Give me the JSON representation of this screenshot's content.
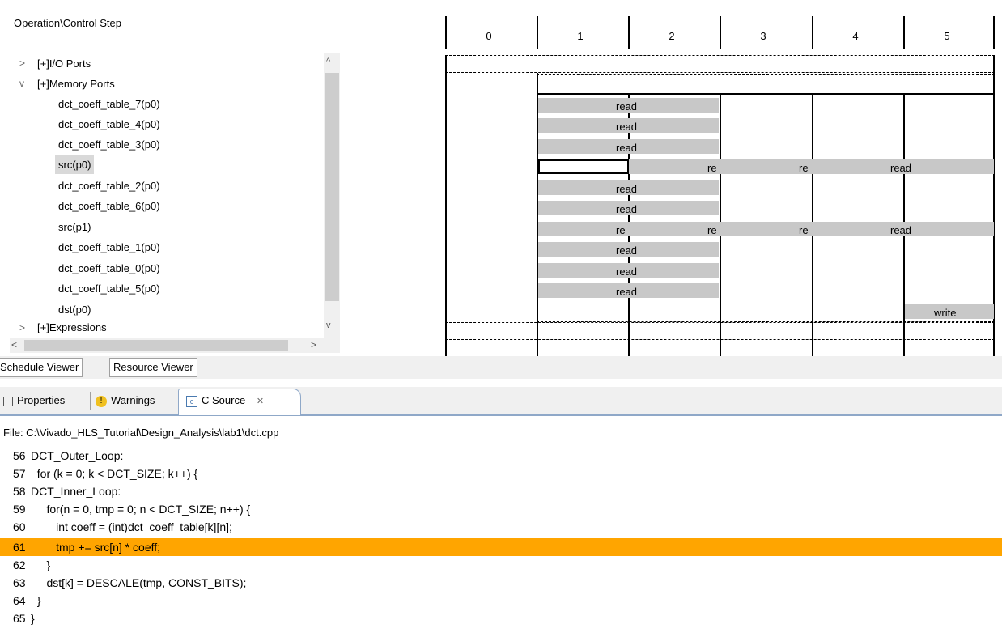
{
  "schedule": {
    "header_label": "Operation\\Control Step",
    "steps": [
      "0",
      "1",
      "2",
      "3",
      "4",
      "5"
    ],
    "tree": [
      {
        "chevron": ">",
        "label": "[+]I/O Ports",
        "indent": 0
      },
      {
        "chevron": "v",
        "label": "[+]Memory Ports",
        "indent": 0
      },
      {
        "label": "dct_coeff_table_7(p0)",
        "indent": 1
      },
      {
        "label": "dct_coeff_table_4(p0)",
        "indent": 1
      },
      {
        "label": "dct_coeff_table_3(p0)",
        "indent": 1
      },
      {
        "label": "src(p0)",
        "indent": 1,
        "selected": true
      },
      {
        "label": "dct_coeff_table_2(p0)",
        "indent": 1
      },
      {
        "label": "dct_coeff_table_6(p0)",
        "indent": 1
      },
      {
        "label": "src(p1)",
        "indent": 1
      },
      {
        "label": "dct_coeff_table_1(p0)",
        "indent": 1
      },
      {
        "label": "dct_coeff_table_0(p0)",
        "indent": 1
      },
      {
        "label": "dct_coeff_table_5(p0)",
        "indent": 1
      },
      {
        "label": "dst(p0)",
        "indent": 1
      },
      {
        "chevron": ">",
        "label": "[+]Expressions",
        "indent": 0
      }
    ],
    "bars": {
      "read": "read",
      "re": "re",
      "write": "write"
    }
  },
  "bottom_tabs": {
    "schedule_viewer": "Schedule Viewer",
    "resource_viewer": "Resource Viewer"
  },
  "views": {
    "properties": "Properties",
    "warnings": "Warnings",
    "c_source": "C Source",
    "close_glyph": "✕"
  },
  "file_path": "File: C:\\Vivado_HLS_Tutorial\\Design_Analysis\\lab1\\dct.cpp",
  "code": [
    {
      "num": "56",
      "text": "DCT_Outer_Loop:"
    },
    {
      "num": "57",
      "text": "  for (k = 0; k < DCT_SIZE; k++) {"
    },
    {
      "num": "58",
      "text": "DCT_Inner_Loop:"
    },
    {
      "num": "59",
      "text": "     for(n = 0, tmp = 0; n < DCT_SIZE; n++) {"
    },
    {
      "num": "60",
      "text": "        int coeff = (int)dct_coeff_table[k][n];"
    },
    {
      "num": "61",
      "text": "        tmp += src[n] * coeff;",
      "highlight": true
    },
    {
      "num": "62",
      "text": "     }"
    },
    {
      "num": "63",
      "text": "     dst[k] = DESCALE(tmp, CONST_BITS);"
    },
    {
      "num": "64",
      "text": "  }"
    },
    {
      "num": "65",
      "text": "}"
    }
  ]
}
